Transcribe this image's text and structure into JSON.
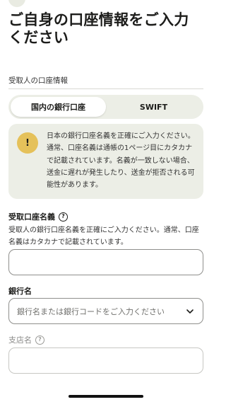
{
  "page": {
    "title_line1": "ご自身の口座情報をご入力",
    "title_line2": "ください"
  },
  "section": {
    "label": "受取人の口座情報"
  },
  "tabs": [
    {
      "label": "国内の銀行口座",
      "active": true
    },
    {
      "label": "SWIFT",
      "active": false
    }
  ],
  "notice": {
    "icon": "exclamation-icon",
    "icon_glyph": "!",
    "text": "日本の銀行口座名義を正確にご入力ください。通常、口座名義は通帳の1ページ目にカタカナで記載されています。名義が一致しない場合、送金に遅れが発生したり、送金が拒否される可能性があります。"
  },
  "fields": {
    "account_name": {
      "label": "受取口座名義",
      "help_glyph": "?",
      "description": "受取人の銀行口座名義を正確にご入力ください。通常、口座名義はカタカナで記載されています。",
      "value": ""
    },
    "bank_name": {
      "label": "銀行名",
      "placeholder": "銀行名または銀行コードをご入力ください"
    },
    "branch_name": {
      "label": "支店名",
      "help_glyph": "?",
      "value": ""
    }
  },
  "colors": {
    "accent_yellow": "#e5c15a",
    "panel_bg": "#eceee6",
    "text": "#1d1d1b"
  }
}
